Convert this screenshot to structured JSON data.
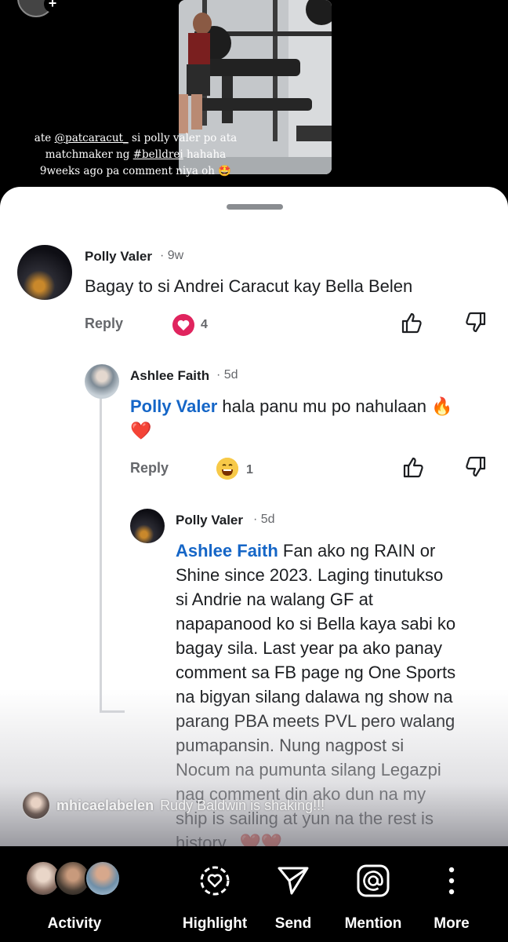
{
  "story": {
    "caption_line1_pre": "ate ",
    "caption_mention": "@patcaracut_",
    "caption_line1_post": " si polly valer po ata",
    "caption_line2_pre": "matchmaker ng ",
    "caption_hashtag": "#belldrei",
    "caption_line2_post": " hahaha",
    "caption_line3": "9weeks ago pa comment niya oh 🤩"
  },
  "comments": [
    {
      "author": "Polly Valer",
      "time": "· 9w",
      "text": "Bagay to si Andrei Caracut kay Bella Belen",
      "reply_label": "Reply",
      "reaction": "heart",
      "reaction_count": "4"
    },
    {
      "author": "Ashlee Faith",
      "time": "· 5d",
      "mention": "Polly Valer",
      "text": " hala panu mu po nahulaan 🔥",
      "text_line2": "❤️",
      "reply_label": "Reply",
      "reaction": "laugh",
      "reaction_count": "1"
    },
    {
      "author": "Polly Valer",
      "time": "· 5d",
      "mention": "Ashlee Faith",
      "lines": [
        " Fan ako ng RAIN or",
        "Shine since 2023. Laging tinutukso",
        "si Andrie na walang GF at",
        "napapanood ko si Bella kaya sabi ko",
        "bagay sila. Last year pa ako panay",
        "comment sa FB page ng One Sports",
        "na bigyan silang dalawa ng show na",
        "parang PBA meets PVL pero walang",
        "pumapansin. Nung nagpost si",
        "Nocum na pumunta silang Legazpi",
        "nag comment din ako dun na my",
        "ship is sailing at yun na the rest is",
        "history.. ❤️❤️"
      ]
    }
  ],
  "live_comment": {
    "user": "mhicaelabelen",
    "text": "Rudy Baldwin is shaking!!!"
  },
  "toolbar": {
    "activity": "Activity",
    "highlight": "Highlight",
    "send": "Send",
    "mention": "Mention",
    "more": "More"
  },
  "colors": {
    "mention_blue": "#1566c7",
    "heart_red": "#e0245e",
    "muted_gray": "#65676b"
  }
}
